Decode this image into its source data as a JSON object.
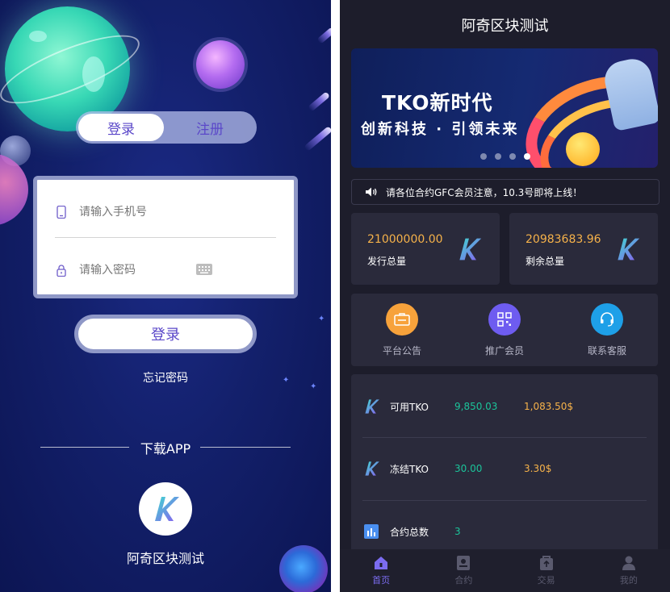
{
  "login": {
    "switch": {
      "login_tab": "登录",
      "register_tab": "注册"
    },
    "phone_placeholder": "请输入手机号",
    "password_placeholder": "请输入密码",
    "login_button": "登录",
    "forgot_password": "忘记密码",
    "download_title": "下载APP",
    "app_name": "阿奇区块测试"
  },
  "home": {
    "title": "阿奇区块测试",
    "banner": {
      "headline": "TKO新时代",
      "subline": "创新科技 · 引领未来",
      "slide_count": 4,
      "active_slide": 4
    },
    "notice": "请各位合约GFC会员注意，10.3号即将上线！",
    "stats": [
      {
        "value": "21000000.00",
        "label": "发行总量"
      },
      {
        "value": "20983683.96",
        "label": "剩余总量"
      }
    ],
    "quick_links": [
      {
        "label": "平台公告",
        "icon": "announcement-icon",
        "color": "#f7a23b"
      },
      {
        "label": "推广会员",
        "icon": "qr-code-icon",
        "color": "#6e5cf0"
      },
      {
        "label": "联系客服",
        "icon": "headset-icon",
        "color": "#1ea0e8"
      }
    ],
    "assets": [
      {
        "name": "可用TKO",
        "amount": "9,850.03",
        "value": "1,083.50$",
        "icon": "k-logo-icon"
      },
      {
        "name": "冻结TKO",
        "amount": "30.00",
        "value": "3.30$",
        "icon": "k-logo-icon"
      },
      {
        "name": "合约总数",
        "amount": "3",
        "value": "",
        "icon": "bar-chart-icon"
      }
    ],
    "tabbar": [
      {
        "label": "首页",
        "icon": "home-icon",
        "active": true
      },
      {
        "label": "合约",
        "icon": "contract-icon",
        "active": false
      },
      {
        "label": "交易",
        "icon": "trade-icon",
        "active": false
      },
      {
        "label": "我的",
        "icon": "user-icon",
        "active": false
      }
    ]
  },
  "colors": {
    "accent": "#5b48c9",
    "gold": "#f6b24a",
    "green": "#1bc49a",
    "tab_active": "#7b6cf0"
  }
}
